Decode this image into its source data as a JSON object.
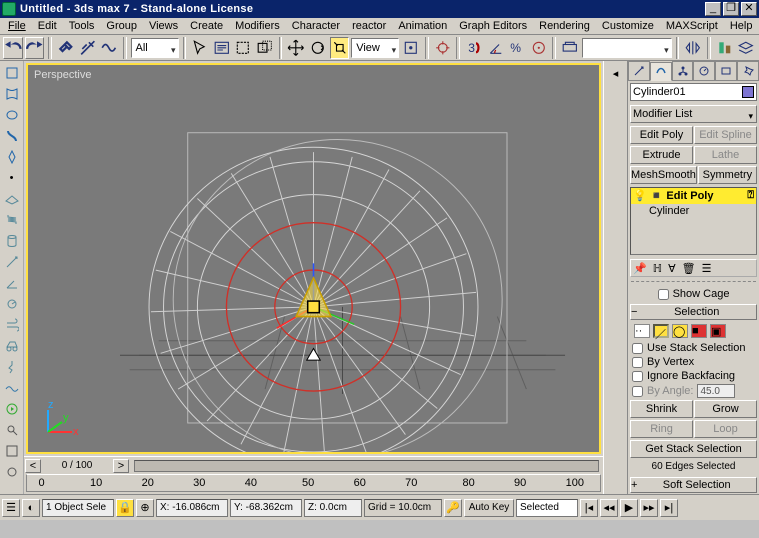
{
  "title": "Untitled - 3ds max 7 - Stand-alone License",
  "menus": [
    "File",
    "Edit",
    "Tools",
    "Group",
    "Views",
    "Create",
    "Modifiers",
    "Character",
    "reactor",
    "Animation",
    "Graph Editors",
    "Rendering",
    "Customize",
    "MAXScript",
    "Help"
  ],
  "toolbar": {
    "selFilter": "All",
    "refFrame": "View"
  },
  "viewport": {
    "label": "Perspective"
  },
  "commandPanel": {
    "objectName": "Cylinder01",
    "colorSwatch": "#7d74d1",
    "modifierList": "Modifier List",
    "quickButtons": [
      {
        "label": "Edit Poly",
        "disabled": false
      },
      {
        "label": "Edit Spline",
        "disabled": true
      },
      {
        "label": "Extrude",
        "disabled": false
      },
      {
        "label": "Lathe",
        "disabled": true
      },
      {
        "label": "MeshSmooth",
        "disabled": false
      },
      {
        "label": "Symmetry",
        "disabled": false
      }
    ],
    "stack": {
      "top": "Edit Poly",
      "base": "Cylinder"
    },
    "showCage": "Show Cage",
    "rollouts": {
      "selectionTitle": "Selection",
      "useStack": "Use Stack Selection",
      "byVertex": "By Vertex",
      "ignoreBack": "Ignore Backfacing",
      "byAngle": "By Angle:",
      "byAngleVal": "45.0",
      "shrink": "Shrink",
      "grow": "Grow",
      "ring": "Ring",
      "loop": "Loop",
      "getStack": "Get Stack Selection",
      "edgesSel": "60 Edges Selected",
      "softSel": "Soft Selection"
    }
  },
  "timeline": {
    "pos": "0 / 100"
  },
  "ruler": {
    "ticks": [
      "0",
      "10",
      "20",
      "30",
      "40",
      "50",
      "60",
      "70",
      "80",
      "90",
      "100"
    ]
  },
  "status": {
    "selCount": "1 Object Sele",
    "x": "X: -16.086cm",
    "y": "Y: -68.362cm",
    "z": "Z: 0.0cm",
    "grid": "Grid = 10.0cm",
    "autokey": "Auto Key",
    "keymode": "Selected"
  }
}
